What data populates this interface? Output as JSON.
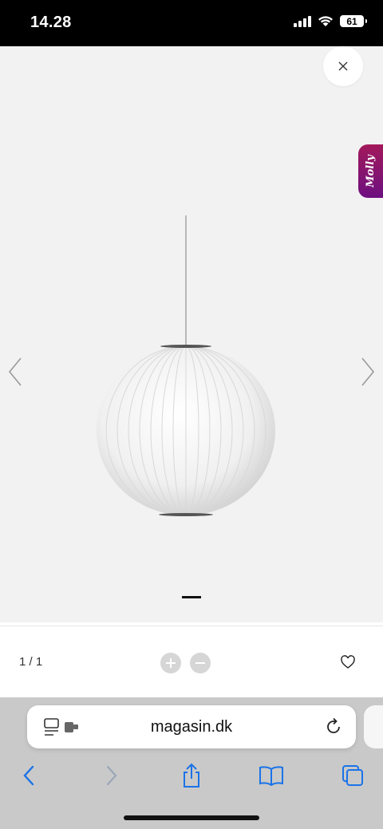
{
  "status_bar": {
    "time": "14.28",
    "battery": "61"
  },
  "gallery": {
    "close_icon": "close-icon",
    "widget_label": "Molly",
    "widget_color": "#a2195b",
    "prev_icon": "chevron-left-icon",
    "next_icon": "chevron-right-icon"
  },
  "toolbar": {
    "page_counter": "1 / 1",
    "zoom_in_icon": "plus-circle-icon",
    "zoom_out_icon": "minus-circle-icon",
    "favorite_icon": "heart-icon"
  },
  "browser": {
    "url": "magasin.dk",
    "accent_color": "#1a73e8"
  }
}
